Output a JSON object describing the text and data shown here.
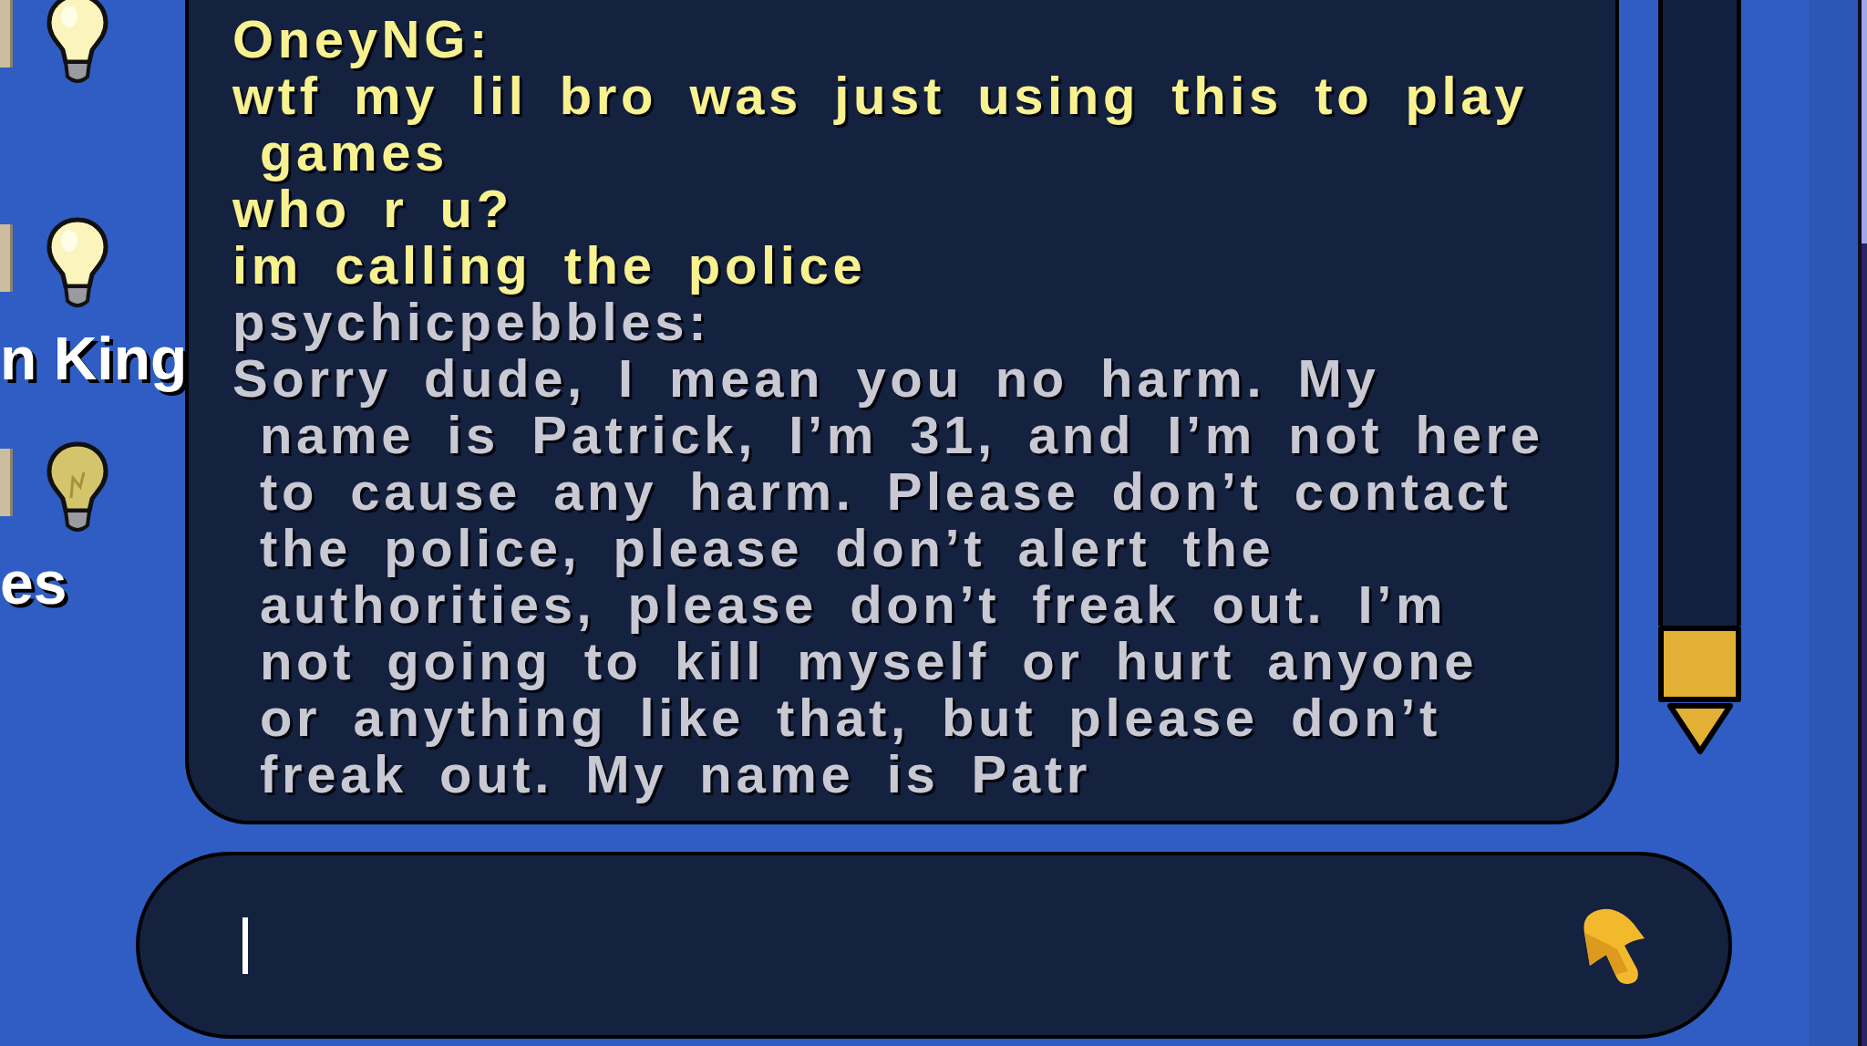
{
  "sidebar": {
    "items": [
      {
        "lit": true
      },
      {
        "lit": true,
        "label": "n King"
      },
      {
        "lit": false,
        "label": "es"
      }
    ]
  },
  "chat": {
    "messages": [
      {
        "author": "OneyNG:",
        "color": "#f7f28f",
        "texts": [
          "wtf my lil bro was just using this to play games",
          "who r u?",
          "im calling the police"
        ]
      },
      {
        "author": "psychicpebbles:",
        "color": "#c9c9d3",
        "texts": [
          "Sorry dude, I mean you no harm. My name is Patrick, I’m 31, and I’m not here to cause any harm. Please don’t contact the police, please don’t alert the authorities, please don’t freak out. I’m not going to kill myself or hurt anyone or anything like that, but please don’t freak out. My name is Patr"
        ]
      }
    ]
  }
}
